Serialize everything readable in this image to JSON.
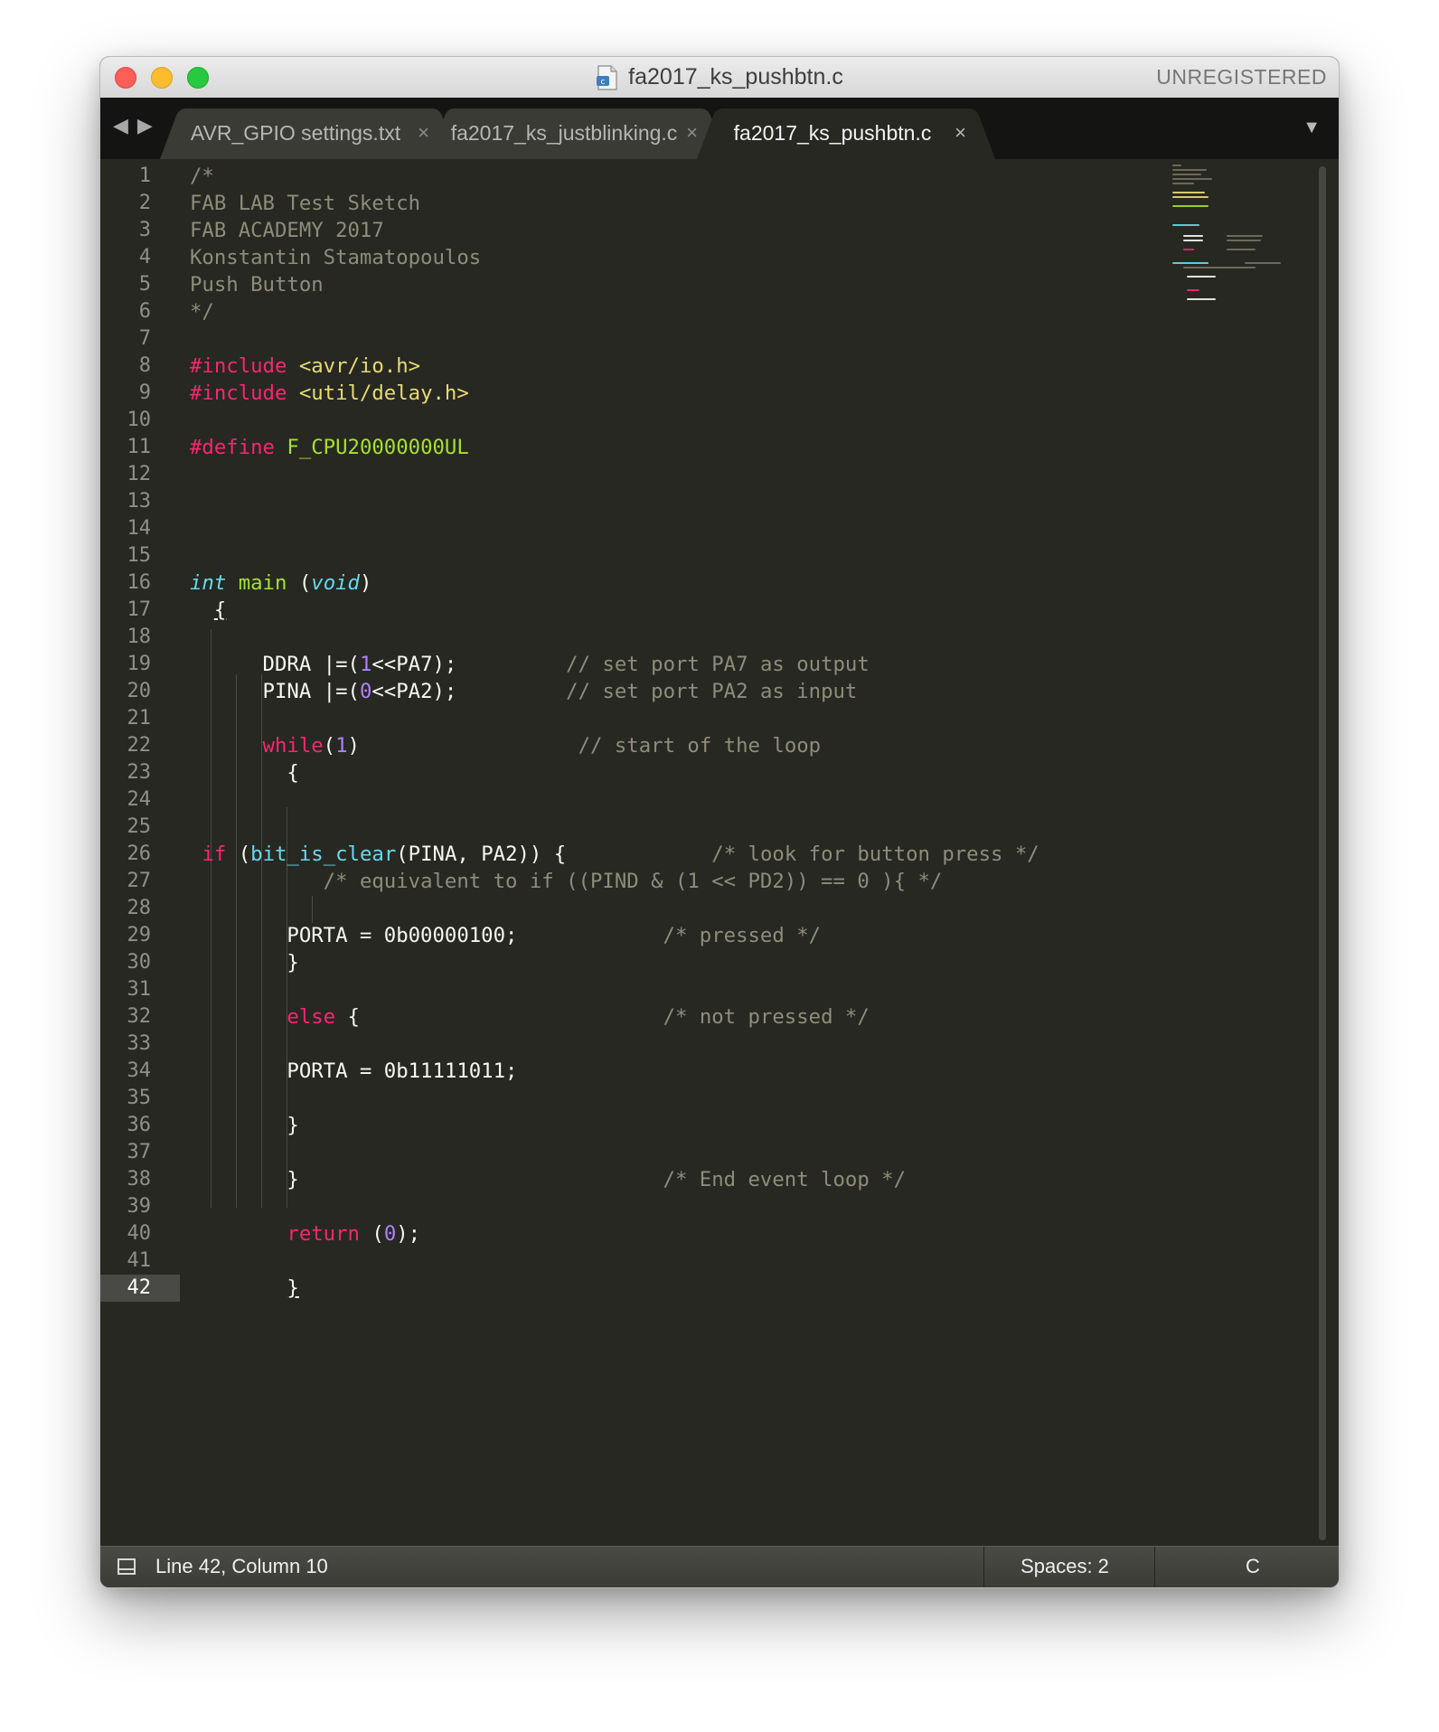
{
  "window": {
    "title": "fa2017_ks_pushbtn.c",
    "registration": "UNREGISTERED"
  },
  "nav": {
    "back": "◀",
    "forward": "▶"
  },
  "tabs": [
    {
      "label": "AVR_GPIO settings.txt",
      "close": "×",
      "active": false
    },
    {
      "label": "fa2017_ks_justblinking.c",
      "close": "×",
      "active": false
    },
    {
      "label": "fa2017_ks_pushbtn.c",
      "close": "×",
      "active": true
    }
  ],
  "tab_menu": "▼",
  "editor": {
    "current_line": 42,
    "line_numbers": [
      "1",
      "2",
      "3",
      "4",
      "5",
      "6",
      "7",
      "8",
      "9",
      "10",
      "11",
      "12",
      "13",
      "14",
      "15",
      "16",
      "17",
      "18",
      "19",
      "20",
      "21",
      "22",
      "23",
      "24",
      "25",
      "26",
      "27",
      "28",
      "29",
      "30",
      "31",
      "32",
      "33",
      "34",
      "35",
      "36",
      "37",
      "38",
      "39",
      "40",
      "41",
      "42"
    ],
    "lines": [
      [
        {
          "t": "/*",
          "c": "cmt"
        }
      ],
      [
        {
          "t": "FAB LAB Test Sketch",
          "c": "cmt"
        }
      ],
      [
        {
          "t": "FAB ACADEMY 2017",
          "c": "cmt"
        }
      ],
      [
        {
          "t": "Konstantin Stamatopoulos",
          "c": "cmt"
        }
      ],
      [
        {
          "t": "Push Button",
          "c": "cmt"
        }
      ],
      [
        {
          "t": "*/",
          "c": "cmt"
        }
      ],
      [],
      [
        {
          "t": "#include ",
          "c": "kw"
        },
        {
          "t": "<avr/io.h>",
          "c": "str"
        }
      ],
      [
        {
          "t": "#include ",
          "c": "kw"
        },
        {
          "t": "<util/delay.h>",
          "c": "str"
        }
      ],
      [],
      [
        {
          "t": "#define ",
          "c": "kw"
        },
        {
          "t": "F_CPU20000000UL",
          "c": "fn"
        }
      ],
      [],
      [],
      [],
      [],
      [
        {
          "t": "int",
          "c": "typ"
        },
        {
          "t": " main ",
          "c": "fn"
        },
        {
          "t": "(",
          "c": "txt"
        },
        {
          "t": "void",
          "c": "typ"
        },
        {
          "t": ")",
          "c": "txt"
        }
      ],
      [
        {
          "t": "  ",
          "c": "txt"
        },
        {
          "t": "{",
          "c": "txt",
          "u": true
        }
      ],
      [],
      [
        {
          "t": "      DDRA |=(",
          "c": "txt"
        },
        {
          "t": "1",
          "c": "num"
        },
        {
          "t": "<<PA7);         ",
          "c": "txt"
        },
        {
          "t": "// set port PA7 as output",
          "c": "cmt"
        }
      ],
      [
        {
          "t": "      PINA |=(",
          "c": "txt"
        },
        {
          "t": "0",
          "c": "num"
        },
        {
          "t": "<<PA2);         ",
          "c": "txt"
        },
        {
          "t": "// set port PA2 as input",
          "c": "cmt"
        }
      ],
      [],
      [
        {
          "t": "      ",
          "c": "txt"
        },
        {
          "t": "while",
          "c": "kw"
        },
        {
          "t": "(",
          "c": "txt"
        },
        {
          "t": "1",
          "c": "num"
        },
        {
          "t": ")                  ",
          "c": "txt"
        },
        {
          "t": "// start of the loop",
          "c": "cmt"
        }
      ],
      [
        {
          "t": "        {",
          "c": "txt"
        }
      ],
      [],
      [],
      [
        {
          "t": " ",
          "c": "txt"
        },
        {
          "t": "if",
          "c": "kw"
        },
        {
          "t": " (",
          "c": "txt"
        },
        {
          "t": "bit_is_clear",
          "c": "bi"
        },
        {
          "t": "(PINA, PA2)) {            ",
          "c": "txt"
        },
        {
          "t": "/* look for button press */",
          "c": "cmt"
        }
      ],
      [
        {
          "t": "           ",
          "c": "txt"
        },
        {
          "t": "/* equivalent to if ((PIND & (1 << PD2)) == 0 ){ */",
          "c": "cmt"
        }
      ],
      [],
      [
        {
          "t": "        PORTA = 0b00000100;            ",
          "c": "txt"
        },
        {
          "t": "/* pressed */",
          "c": "cmt"
        }
      ],
      [
        {
          "t": "        }",
          "c": "txt"
        }
      ],
      [],
      [
        {
          "t": "        ",
          "c": "txt"
        },
        {
          "t": "else",
          "c": "kw"
        },
        {
          "t": " {                         ",
          "c": "txt"
        },
        {
          "t": "/* not pressed */",
          "c": "cmt"
        }
      ],
      [],
      [
        {
          "t": "        PORTA = 0b11111011;",
          "c": "txt"
        }
      ],
      [],
      [
        {
          "t": "        }",
          "c": "txt"
        }
      ],
      [],
      [
        {
          "t": "        }                              ",
          "c": "txt"
        },
        {
          "t": "/* End event loop */",
          "c": "cmt"
        }
      ],
      [],
      [
        {
          "t": "        ",
          "c": "txt"
        },
        {
          "t": "return",
          "c": "kw"
        },
        {
          "t": " (",
          "c": "txt"
        },
        {
          "t": "0",
          "c": "num"
        },
        {
          "t": ");",
          "c": "txt"
        }
      ],
      [],
      [
        {
          "t": "        ",
          "c": "txt"
        },
        {
          "t": "}",
          "c": "txt",
          "u": true
        }
      ]
    ]
  },
  "status": {
    "position": "Line 42, Column 10",
    "indentation": "Spaces: 2",
    "syntax": "C"
  },
  "colors": {
    "background": "#272822",
    "comment": "#8f8c7a",
    "keyword": "#f92672",
    "string": "#e6db74",
    "function": "#a6e22e",
    "type": "#66d9ef",
    "number": "#ae81ff",
    "text": "#f8f8f2"
  },
  "icons": {
    "file": "c-source-file-icon",
    "status_panel": "panel-toggle-icon"
  }
}
